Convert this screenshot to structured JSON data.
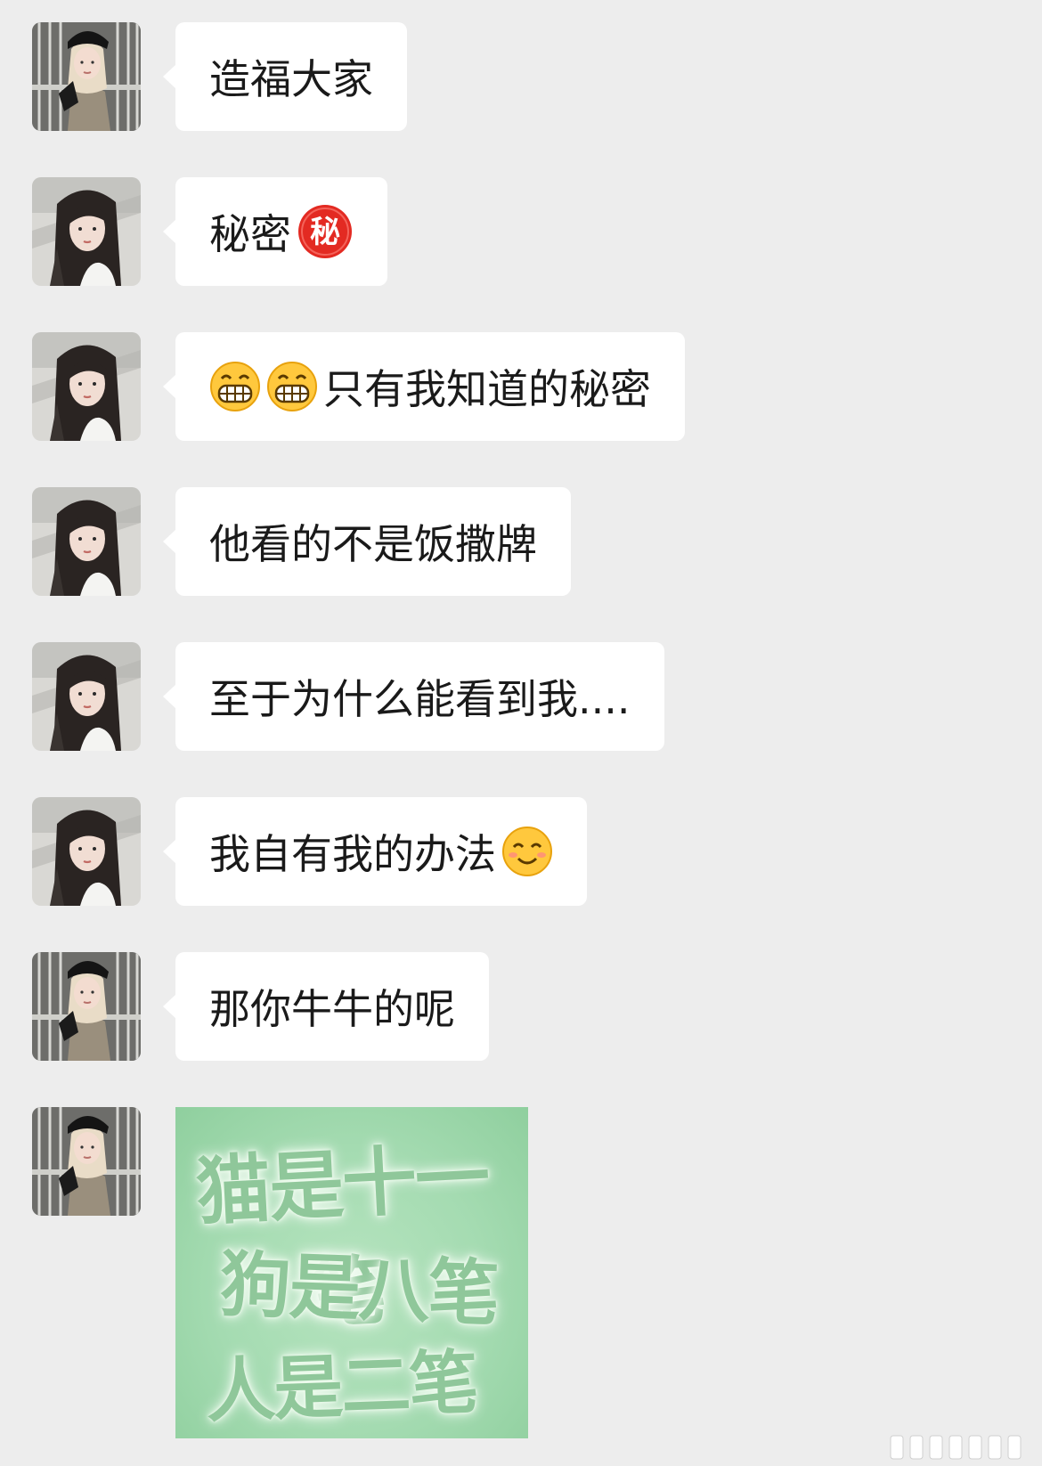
{
  "messages": [
    {
      "avatar": "avatar-blonde",
      "text": "造福大家"
    },
    {
      "avatar": "avatar-dark-hair",
      "text": "秘密",
      "emoji_after": "secret-emoji"
    },
    {
      "avatar": "avatar-dark-hair",
      "emoji_before": "grin-emoji",
      "text": "只有我知道的秘密"
    },
    {
      "avatar": "avatar-dark-hair",
      "text": "他看的不是饭撒牌"
    },
    {
      "avatar": "avatar-dark-hair",
      "text": "至于为什么能看到我...."
    },
    {
      "avatar": "avatar-dark-hair",
      "text": "我自有我的办法",
      "emoji_after": "smile-emoji"
    },
    {
      "avatar": "avatar-blonde",
      "text": "那你牛牛的呢"
    },
    {
      "avatar": "avatar-blonde",
      "sticker": {
        "line1": "猫是十一笔",
        "line2": "狗是八笔",
        "line3": "人是二笔"
      }
    }
  ],
  "emoji_glyphs": {
    "secret": "秘"
  },
  "colors": {
    "background": "#ededed",
    "bubble": "#ffffff",
    "sticker_bg": "#a4dbb1",
    "secret_badge": "#e02020"
  }
}
